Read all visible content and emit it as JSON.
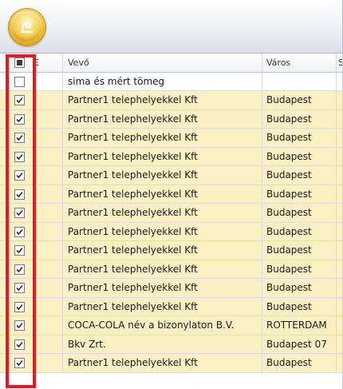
{
  "toolbar": {
    "app_button_icon": "ribbon-app-orb-icon"
  },
  "grid": {
    "columns": [
      {
        "key": "check",
        "label": ""
      },
      {
        "key": "e",
        "label": "E"
      },
      {
        "key": "buyer",
        "label": "Vevő"
      },
      {
        "key": "city",
        "label": "Város"
      },
      {
        "key": "s",
        "label": "S"
      }
    ],
    "header_checkbox_state": "indeterminate",
    "rows": [
      {
        "checked": false,
        "buyer": "sima és mért tömeg",
        "city": ""
      },
      {
        "checked": true,
        "buyer": "Partner1 telephelyekkel Kft",
        "city": "Budapest"
      },
      {
        "checked": true,
        "buyer": "Partner1 telephelyekkel Kft",
        "city": "Budapest"
      },
      {
        "checked": true,
        "buyer": "Partner1 telephelyekkel Kft",
        "city": "Budapest"
      },
      {
        "checked": true,
        "buyer": "Partner1 telephelyekkel Kft",
        "city": "Budapest"
      },
      {
        "checked": true,
        "buyer": "Partner1 telephelyekkel Kft",
        "city": "Budapest"
      },
      {
        "checked": true,
        "buyer": "Partner1 telephelyekkel Kft",
        "city": "Budapest"
      },
      {
        "checked": true,
        "buyer": "Partner1 telephelyekkel Kft",
        "city": "Budapest"
      },
      {
        "checked": true,
        "buyer": "Partner1 telephelyekkel Kft",
        "city": "Budapest"
      },
      {
        "checked": true,
        "buyer": "Partner1 telephelyekkel Kft",
        "city": "Budapest"
      },
      {
        "checked": true,
        "buyer": "Partner1 telephelyekkel Kft",
        "city": "Budapest"
      },
      {
        "checked": true,
        "buyer": "Partner1 telephelyekkel Kft",
        "city": "Budapest"
      },
      {
        "checked": true,
        "buyer": "Partner1 telephelyekkel Kft",
        "city": "Budapest"
      },
      {
        "checked": true,
        "buyer": "COCA-COLA név a bizonylaton B.V.",
        "city": "ROTTERDAM"
      },
      {
        "checked": true,
        "buyer": "Bkv Zrt.",
        "city": "Budapest 07"
      },
      {
        "checked": true,
        "buyer": "Partner1 telephelyekkel Kft",
        "city": "Budapest"
      }
    ]
  },
  "colors": {
    "row_highlight": "#fbf0c3",
    "annotation_border": "#e11b22",
    "orb_gold": "#f6cf52"
  }
}
